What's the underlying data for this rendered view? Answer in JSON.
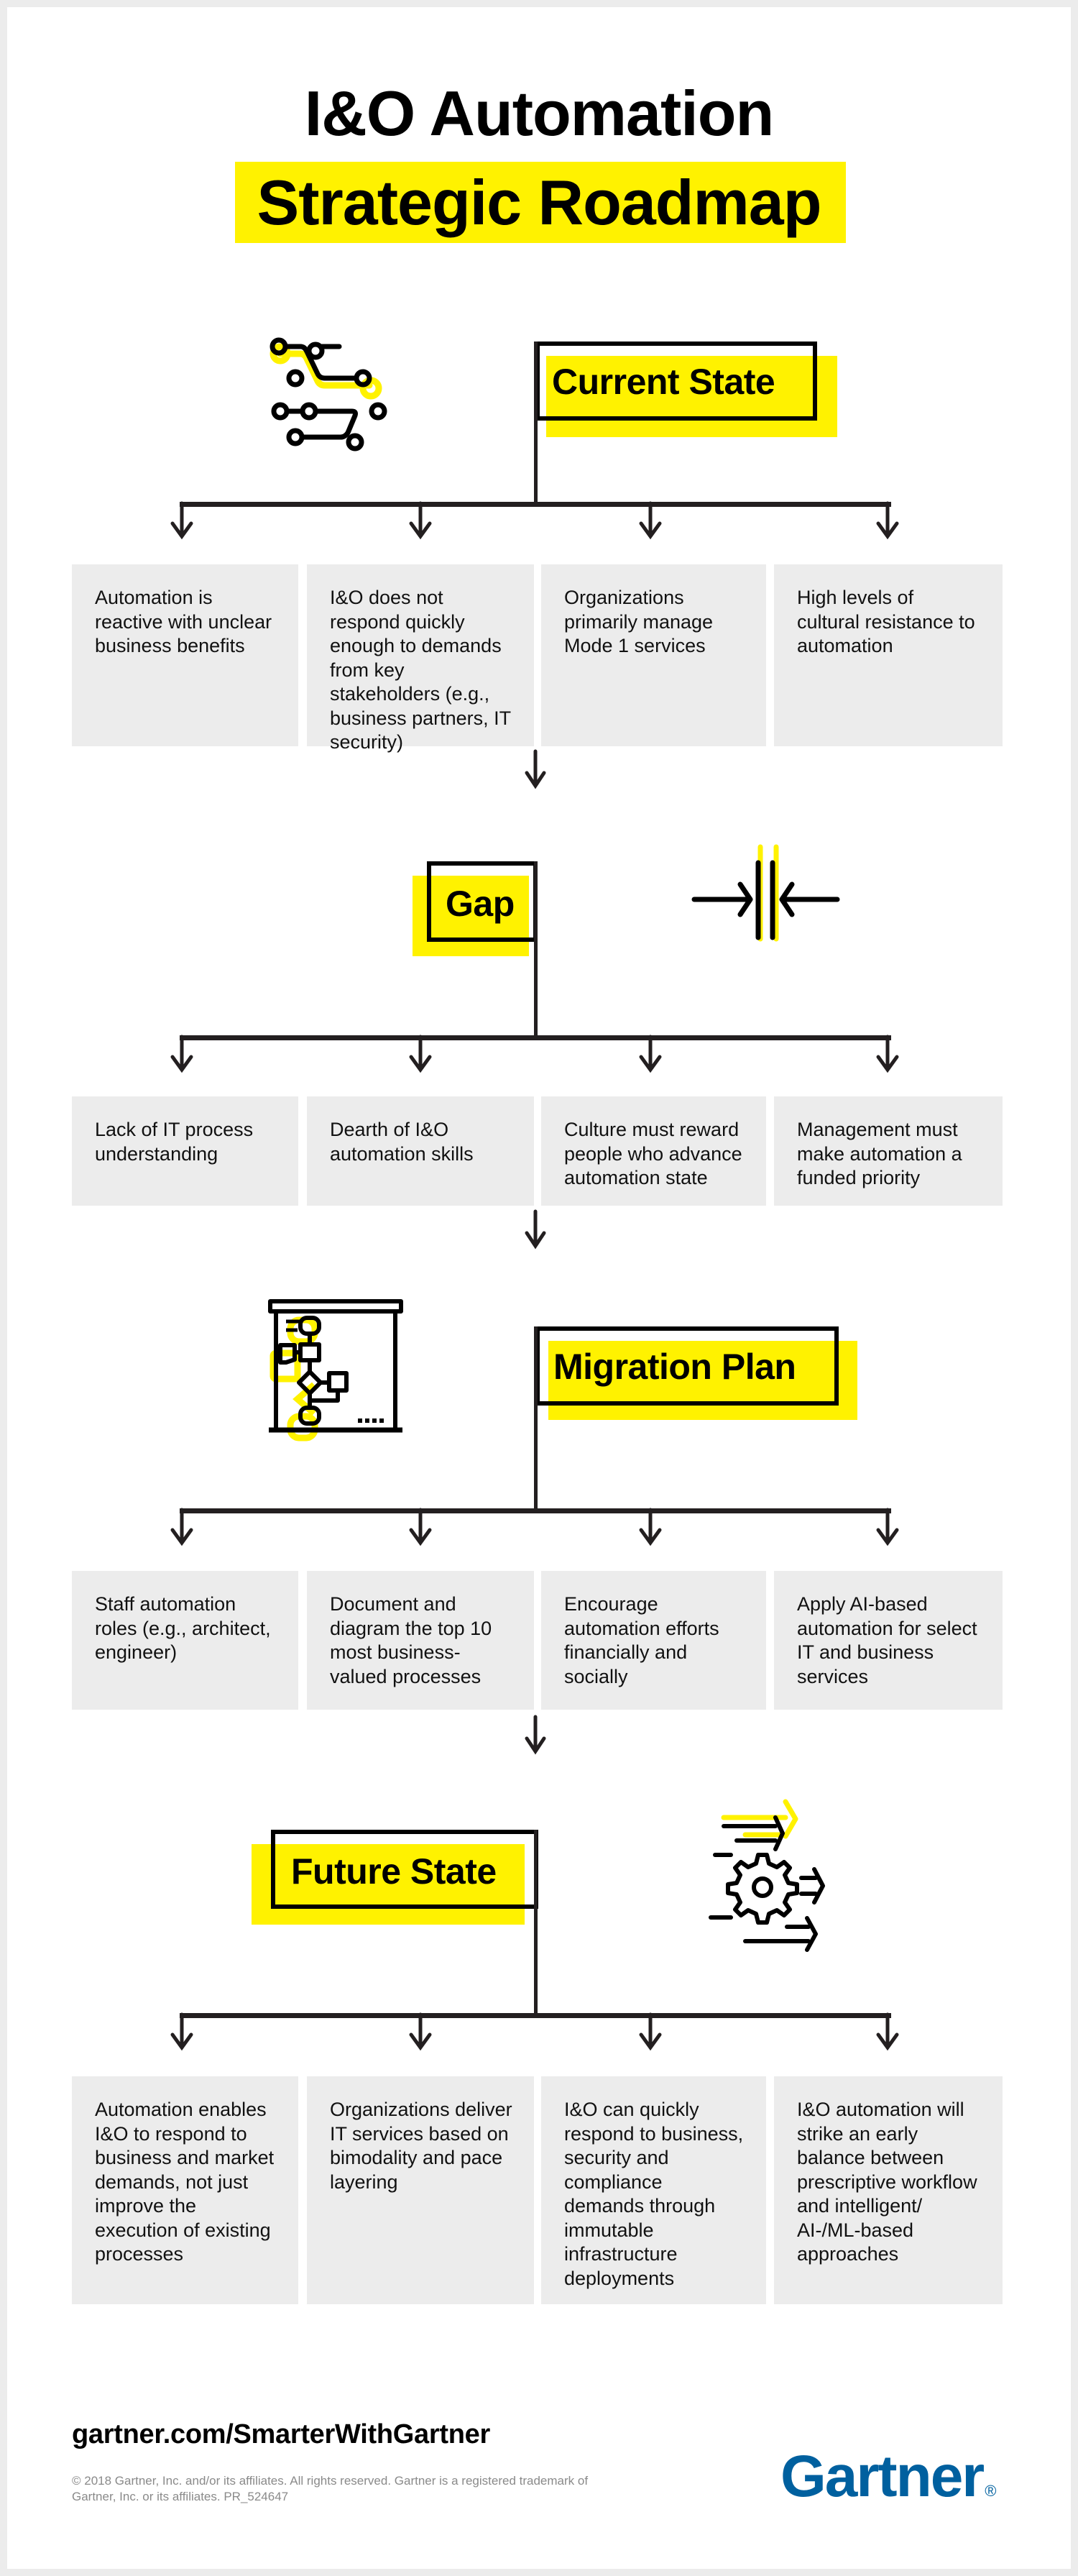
{
  "header": {
    "title_line1": "I&O Automation",
    "title_line2": "Strategic Roadmap"
  },
  "colors": {
    "accent_yellow": "#fff200",
    "box_gray": "#ececec",
    "brand_blue": "#00609f",
    "line": "#231f20"
  },
  "sections": [
    {
      "label": "Current State",
      "icon": "circuit-icon",
      "items": [
        "Automation is reactive with unclear business benefits",
        "I&O does not respond quickly enough to demands from key stakeholders (e.g., business partners, IT security)",
        "Organizations primarily manage Mode 1 services",
        "High levels of cultural resistance to automation"
      ]
    },
    {
      "label": "Gap",
      "icon": "converging-arrows-icon",
      "items": [
        "Lack of IT process understanding",
        "Dearth of I&O automation skills",
        "Culture must reward people who advance automation state",
        "Management must make automation a funded priority"
      ]
    },
    {
      "label": "Migration Plan",
      "icon": "flowchart-icon",
      "items": [
        "Staff automation roles (e.g., architect, engineer)",
        "Document and diagram the top 10 most business-valued processes",
        "Encourage automation efforts financially and socially",
        "Apply AI-based automation for select IT and business services"
      ]
    },
    {
      "label": "Future State",
      "icon": "gear-arrows-icon",
      "items": [
        "Automation enables I&O to respond to business and market demands, not just improve the execution of existing processes",
        "Organizations deliver IT services based on bimodality and pace layering",
        "I&O can quickly respond to business, security and compliance demands through immutable infrastructure deployments",
        "I&O automation will strike an early balance between prescriptive workflow and intelligent/ AI-/ML-based approaches"
      ]
    }
  ],
  "footer": {
    "url": "gartner.com/SmarterWithGartner",
    "copyright": "© 2018 Gartner, Inc. and/or its affiliates. All rights reserved. Gartner is a registered trademark of Gartner, Inc. or its affiliates. PR_524647",
    "logo_text": "Gartner",
    "logo_mark": "®"
  }
}
